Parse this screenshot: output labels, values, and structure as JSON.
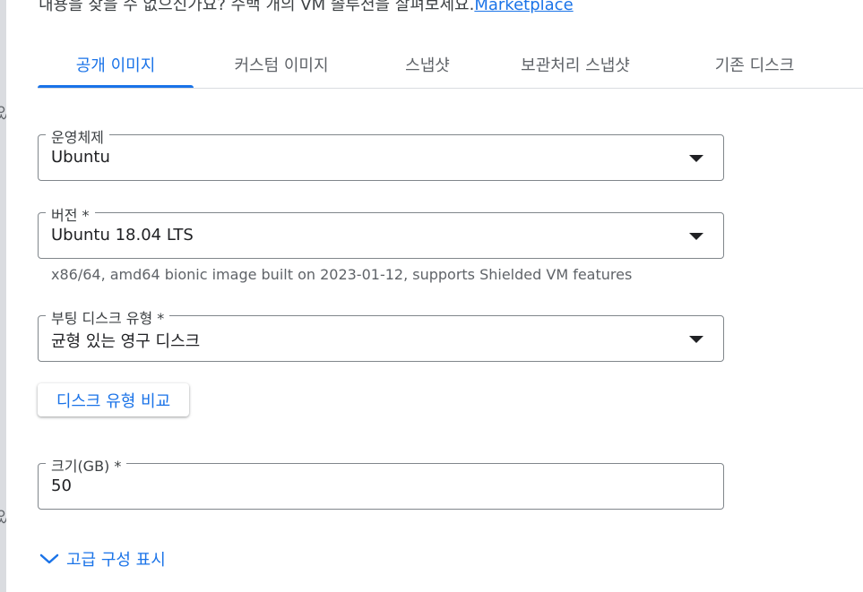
{
  "left_fragments": [
    "있",
    "i",
    "있"
  ],
  "intro": {
    "text": "내용을 찾을 수 없으신가요? 수백 개의 VM 솔루션을 살펴보세요.",
    "link": "Marketplace"
  },
  "tabs": [
    {
      "label": "공개 이미지",
      "active": true
    },
    {
      "label": "커스텀 이미지",
      "active": false
    },
    {
      "label": "스냅샷",
      "active": false
    },
    {
      "label": "보관처리 스냅샷",
      "active": false
    },
    {
      "label": "기존 디스크",
      "active": false
    }
  ],
  "os_field": {
    "label": "운영체제",
    "value": "Ubuntu"
  },
  "version_field": {
    "label": "버전 *",
    "value": "Ubuntu 18.04 LTS",
    "hint": "x86/64, amd64 bionic image built on 2023-01-12, supports Shielded VM features"
  },
  "disk_type_field": {
    "label": "부팅 디스크 유형 *",
    "value": "균형 있는 영구 디스크"
  },
  "compare_button": "디스크 유형 비교",
  "size_field": {
    "label": "크기(GB) *",
    "value": "50"
  },
  "advanced_toggle": {
    "label": "고급 구성 표시",
    "icon": "chevron-down-icon"
  },
  "colors": {
    "accent": "#1a73e8",
    "border": "#80868b",
    "text": "#202124",
    "muted": "#5f6368"
  }
}
